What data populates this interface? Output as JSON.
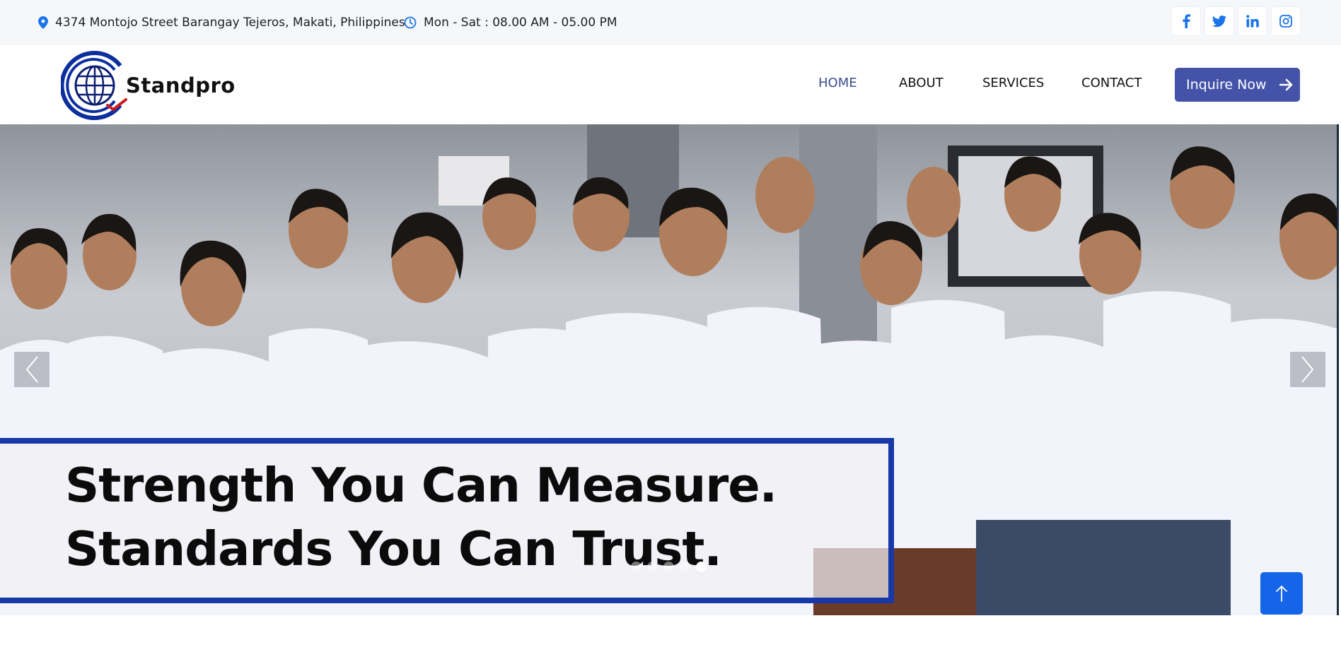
{
  "topbar": {
    "address": "4374 Montojo Street Barangay Tejeros, Makati, Philippines",
    "hours": "Mon - Sat : 08.00 AM - 05.00 PM",
    "accent_color": "#1a73e8",
    "socials": [
      "facebook-icon",
      "twitter-icon",
      "linkedin-icon",
      "instagram-icon"
    ]
  },
  "header": {
    "logo_text": "Standpro",
    "nav": {
      "home": "HOME",
      "about": "ABOUT",
      "services": "SERVICES",
      "contact": "CONTACT"
    },
    "cta_label": "Inquire Now",
    "active_color": "#3c4f8f",
    "cta_color": "#4453a8"
  },
  "hero": {
    "headline_1": "Strength You Can Measure.",
    "headline_2": "Standards You Can Trust.",
    "slide_count": 5,
    "active_slide": 5,
    "frame_color": "#1638a8"
  },
  "to_top_color": "#1565e8"
}
